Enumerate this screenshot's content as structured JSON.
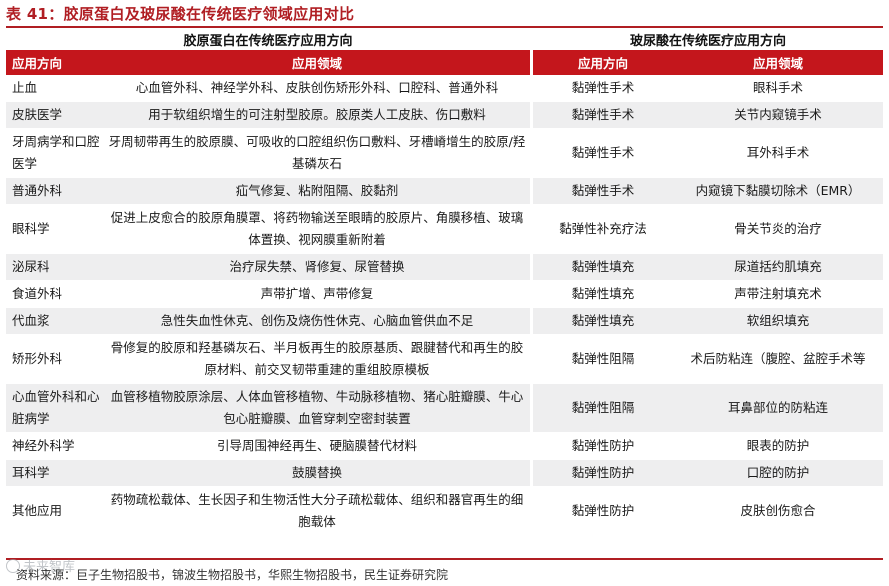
{
  "title": "表 41：胶原蛋白及玻尿酸在传统医疗领域应用对比",
  "groups": {
    "left": "胶原蛋白在传统医疗应用方向",
    "right": "玻尿酸在传统医疗应用方向"
  },
  "headers": [
    "应用方向",
    "应用领域",
    "应用方向",
    "应用领域"
  ],
  "rows": [
    {
      "c0": "止血",
      "c1": "心血管外科、神经学外科、皮肤创伤矫形外科、口腔科、普通外科",
      "c2": "黏弹性手术",
      "c3": "眼科手术"
    },
    {
      "c0": "皮肤医学",
      "c1": "用于软组织增生的可注射型胶原。胶原类人工皮肤、伤口敷料",
      "c2": "黏弹性手术",
      "c3": "关节内窥镜手术"
    },
    {
      "c0": "牙周病学和口腔医学",
      "c1": "牙周韧带再生的胶原膜、可吸收的口腔组织伤口敷料、牙槽嵴增生的胶原/羟基磷灰石",
      "c2": "黏弹性手术",
      "c3": "耳外科手术"
    },
    {
      "c0": "普通外科",
      "c1": "疝气修复、粘附阻隔、胶黏剂",
      "c2": "黏弹性手术",
      "c3": "内窥镜下黏膜切除术（EMR）"
    },
    {
      "c0": "眼科学",
      "c1": "促进上皮愈合的胶原角膜罩、将药物输送至眼睛的胶原片、角膜移植、玻璃体置换、视网膜重新附着",
      "c2": "黏弹性补充疗法",
      "c3": "骨关节炎的治疗"
    },
    {
      "c0": "泌尿科",
      "c1": "治疗尿失禁、肾修复、尿管替换",
      "c2": "黏弹性填充",
      "c3": "尿道括约肌填充"
    },
    {
      "c0": "食道外科",
      "c1": "声带扩增、声带修复",
      "c2": "黏弹性填充",
      "c3": "声带注射填充术"
    },
    {
      "c0": "代血浆",
      "c1": "急性失血性休克、创伤及烧伤性休克、心脑血管供血不足",
      "c2": "黏弹性填充",
      "c3": "软组织填充"
    },
    {
      "c0": "矫形外科",
      "c1": "骨修复的胶原和羟基磷灰石、半月板再生的胶原基质、跟腱替代和再生的胶原材料、前交叉韧带重建的重组胶原模板",
      "c2": "黏弹性阻隔",
      "c3": "术后防粘连（腹腔、盆腔手术等"
    },
    {
      "c0": "心血管外科和心脏病学",
      "c1": "血管移植物胶原涂层、人体血管移植物、牛动脉移植物、猪心脏瓣膜、牛心包心脏瓣膜、血管穿刺空密封装置",
      "c2": "黏弹性阻隔",
      "c3": "耳鼻部位的防粘连"
    },
    {
      "c0": "神经外科学",
      "c1": "引导周围神经再生、硬脑膜替代材料",
      "c2": "黏弹性防护",
      "c3": "眼表的防护"
    },
    {
      "c0": "耳科学",
      "c1": "鼓膜替换",
      "c2": "黏弹性防护",
      "c3": "口腔的防护"
    },
    {
      "c0": "其他应用",
      "c1": "药物疏松载体、生长因子和生物活性大分子疏松载体、组织和器官再生的细胞载体",
      "c2": "黏弹性防护",
      "c3": "皮肤创伤愈合"
    }
  ],
  "source": "资料来源：巨子生物招股书，锦波生物招股书，华熙生物招股书，民生证券研究院",
  "watermark": "未来智库",
  "colors": {
    "accent": "#c4161c",
    "stripe": "#eeeeef"
  }
}
